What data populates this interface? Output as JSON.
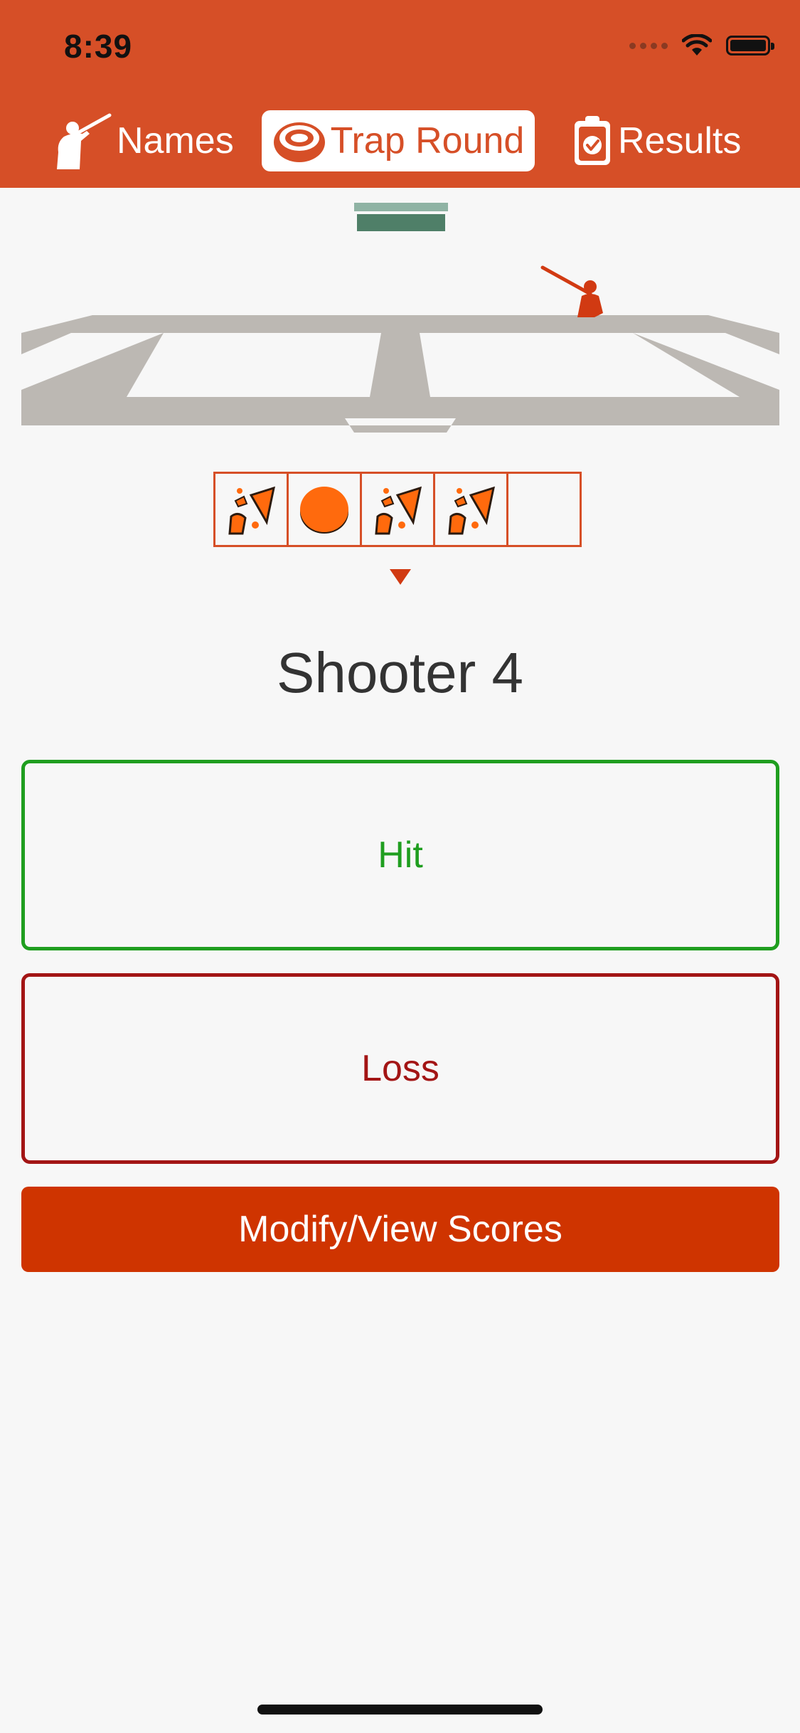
{
  "status_bar": {
    "time": "8:39"
  },
  "tabs": [
    {
      "label": "Names",
      "icon": "shooter-icon",
      "selected": false
    },
    {
      "label": "Trap Round",
      "icon": "clay-target-icon",
      "selected": true
    },
    {
      "label": "Results",
      "icon": "clipboard-check-icon",
      "selected": false
    }
  ],
  "scores": [
    "hit",
    "miss",
    "hit",
    "hit",
    "empty"
  ],
  "current_shooter": "Shooter 4",
  "buttons": {
    "hit": "Hit",
    "loss": "Loss",
    "modify": "Modify/View Scores"
  },
  "colors": {
    "header": "#d64f27",
    "accent": "#cf3400",
    "hit": "#1f9e1f",
    "loss": "#a31515",
    "field": "#bcb8b3"
  }
}
